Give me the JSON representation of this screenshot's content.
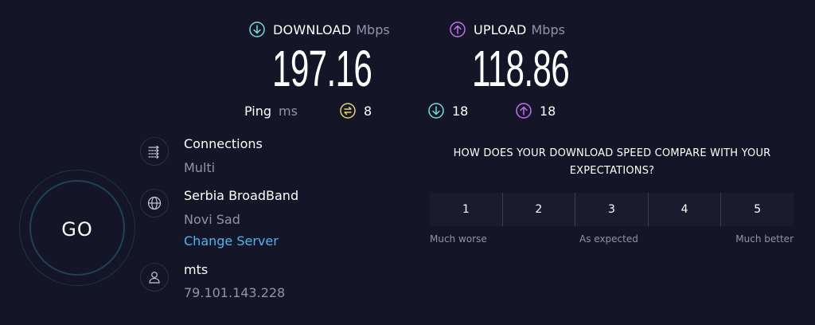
{
  "download": {
    "label": "DOWNLOAD",
    "unit": "Mbps",
    "value": "197.16"
  },
  "upload": {
    "label": "UPLOAD",
    "unit": "Mbps",
    "value": "118.86"
  },
  "ping": {
    "label": "Ping",
    "unit": "ms",
    "idle": "8",
    "download": "18",
    "upload": "18"
  },
  "go_button": {
    "label": "GO"
  },
  "connections": {
    "title": "Connections",
    "mode": "Multi"
  },
  "server": {
    "name": "Serbia BroadBand",
    "city": "Novi Sad",
    "change_label": "Change Server"
  },
  "provider": {
    "name": "mts",
    "ip": "79.101.143.228"
  },
  "survey": {
    "question": "HOW DOES YOUR DOWNLOAD SPEED COMPARE WITH YOUR EXPECTATIONS?",
    "ratings": [
      "1",
      "2",
      "3",
      "4",
      "5"
    ],
    "low_label": "Much worse",
    "mid_label": "As expected",
    "high_label": "Much better"
  },
  "colors": {
    "background": "#141526",
    "download_accent": "#6fe0d8",
    "upload_accent": "#bf71f2",
    "ping_idle_accent": "#e8d36a",
    "link": "#4cb6f4",
    "muted_text": "#9193a8"
  },
  "icons": {
    "download": "arrow-down-circle-icon",
    "upload": "arrow-up-circle-icon",
    "ping_idle": "swap-circle-icon",
    "connections": "connections-icon",
    "server": "globe-icon",
    "provider": "user-icon"
  }
}
